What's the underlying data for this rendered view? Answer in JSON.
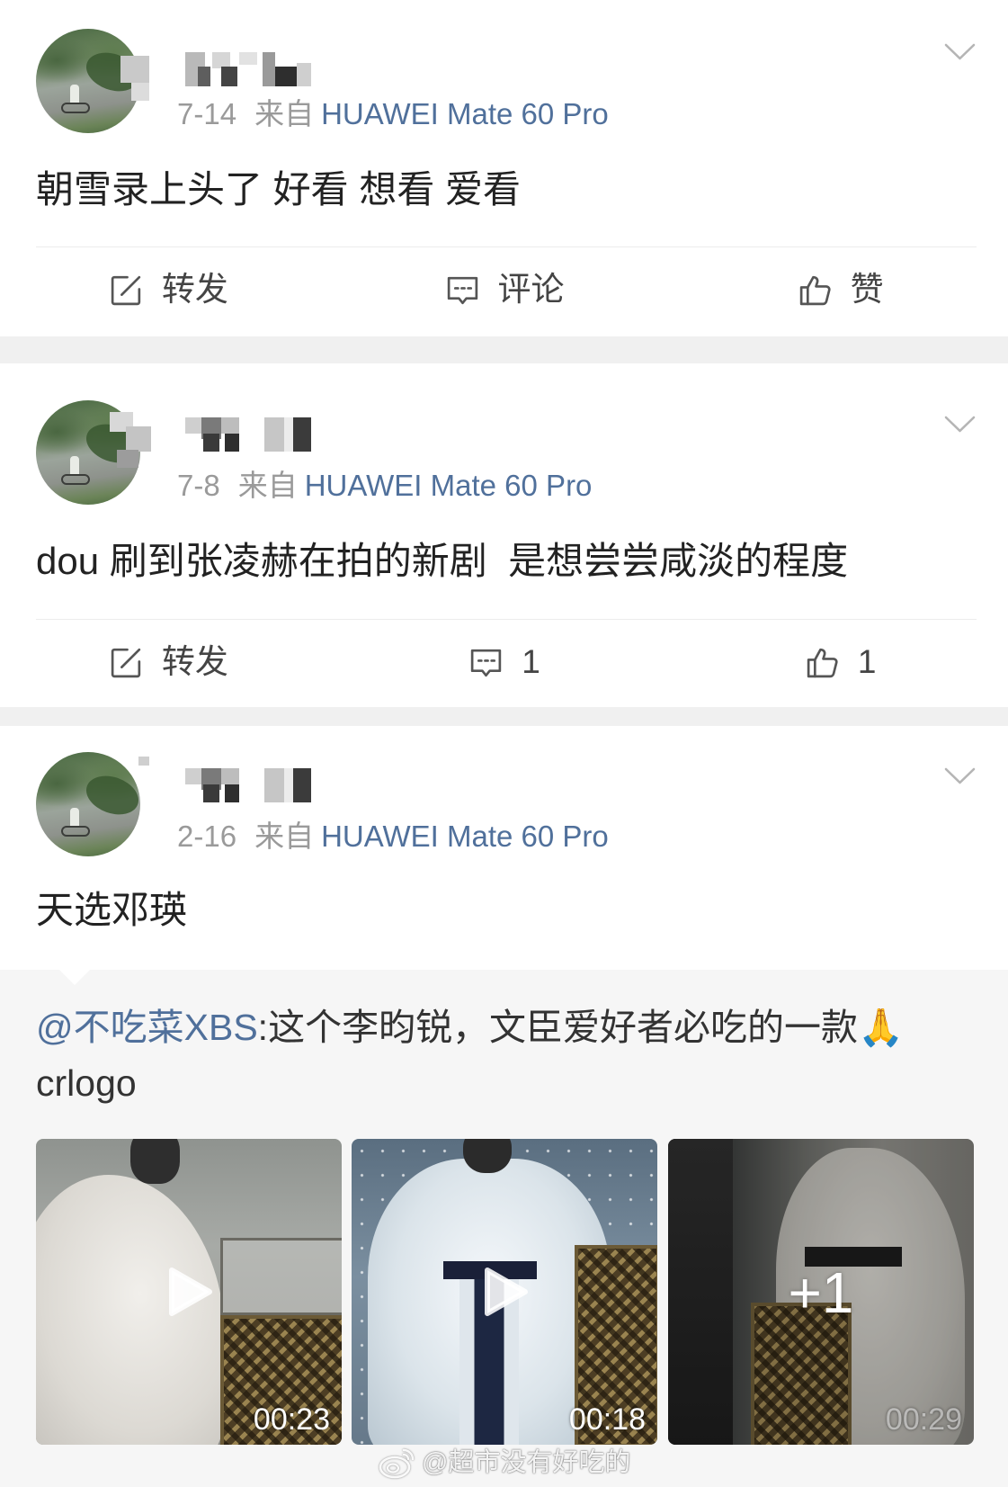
{
  "posts": [
    {
      "time": "7-14",
      "source_prefix": "来自",
      "device": "HUAWEI Mate 60 Pro",
      "text": "朝雪录上头了 好看 想看 爱看",
      "actions": {
        "repost": "转发",
        "comment": "评论",
        "like": "赞"
      }
    },
    {
      "time": "7-8",
      "source_prefix": "来自",
      "device": "HUAWEI Mate 60 Pro",
      "text": "dou 刷到张凌赫在拍的新剧  是想尝尝咸淡的程度",
      "actions": {
        "repost": "转发",
        "comment": "1",
        "like": "1"
      }
    },
    {
      "time": "2-16",
      "source_prefix": "来自",
      "device": "HUAWEI Mate 60 Pro",
      "text": "天选邓瑛",
      "retweet": {
        "mention": "@不吃菜XBS",
        "text": ":这个李昀锐，文臣爱好者必吃的一款🙏",
        "extra_line": "crlogo",
        "videos": [
          {
            "duration": "00:23"
          },
          {
            "duration": "00:18"
          },
          {
            "duration": "00:29",
            "more_count": "+1"
          }
        ]
      }
    }
  ],
  "watermark": "@超市没有好吃的",
  "icons": {
    "menu": "chevron-down-icon",
    "repost": "repost-icon",
    "comment": "comment-icon",
    "like": "thumbs-up-icon",
    "play": "play-icon",
    "watermark": "weibo-logo-icon"
  },
  "colors": {
    "link_blue": "#50709b",
    "post_text": "#222222",
    "meta_gray": "#9a9a9a",
    "feed_separator": "#f0f0f0",
    "retweet_background": "#f6f6f6"
  }
}
